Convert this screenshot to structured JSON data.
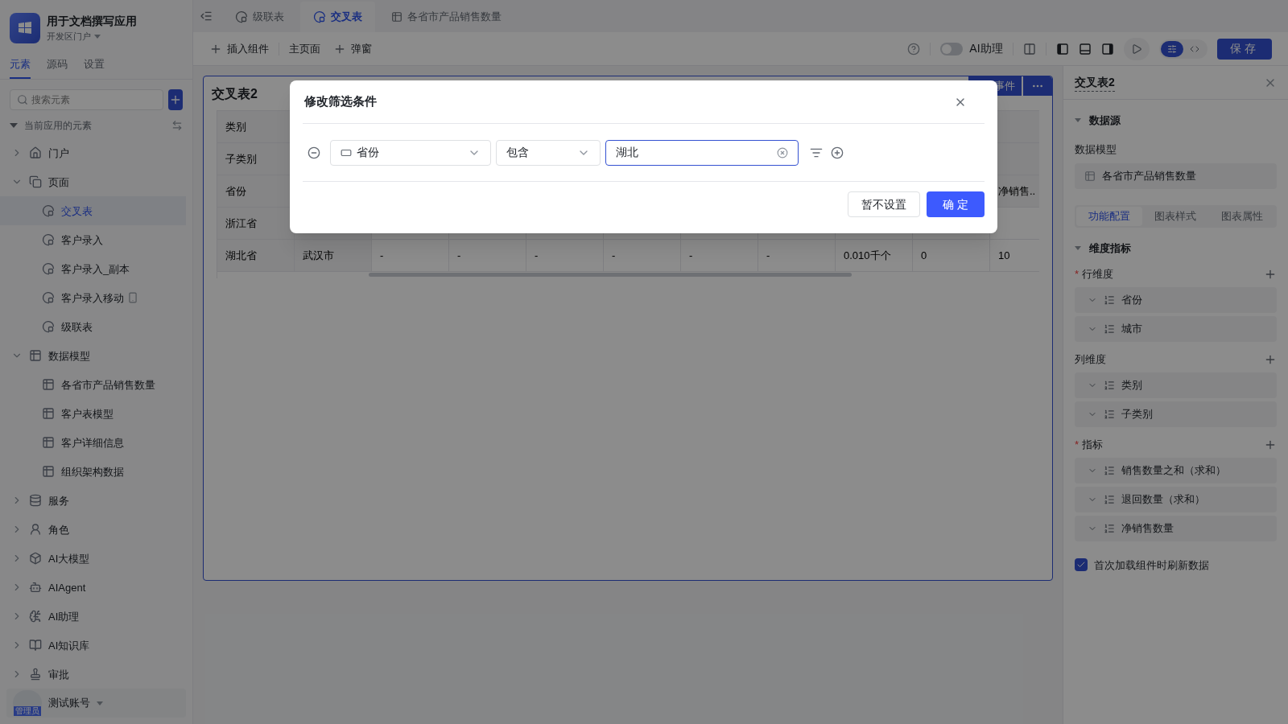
{
  "app": {
    "name": "用于文档撰写应用",
    "portal": "开发区门户"
  },
  "sidebar": {
    "tabs": [
      {
        "label": "元素",
        "selected": true
      },
      {
        "label": "源码",
        "selected": false
      },
      {
        "label": "设置",
        "selected": false
      }
    ],
    "search": {
      "placeholder": "搜索元素"
    },
    "tree": {
      "label": "当前应用的元素",
      "expanded": true,
      "children": [
        {
          "label": "门户",
          "kind": "portal",
          "expanded": false,
          "selected": false
        },
        {
          "label": "页面",
          "kind": "page",
          "expanded": true,
          "selected": false,
          "children": [
            {
              "label": "交叉表",
              "kind": "page-item",
              "selected": true
            },
            {
              "label": "客户录入",
              "kind": "page-item",
              "selected": false
            },
            {
              "label": "客户录入_副本",
              "kind": "page-item",
              "selected": false
            },
            {
              "label": "客户录入移动",
              "kind": "page-item",
              "selected": false,
              "mobile": true
            },
            {
              "label": "级联表",
              "kind": "page-item",
              "selected": false
            }
          ]
        },
        {
          "label": "数据模型",
          "kind": "data-model",
          "expanded": true,
          "selected": false,
          "children": [
            {
              "label": "各省市产品销售数量",
              "kind": "table",
              "selected": false
            },
            {
              "label": "客户表模型",
              "kind": "table",
              "selected": false
            },
            {
              "label": "客户详细信息",
              "kind": "table",
              "selected": false
            },
            {
              "label": "组织架构数据",
              "kind": "table",
              "selected": false
            }
          ]
        },
        {
          "label": "服务",
          "kind": "service",
          "expanded": false,
          "selected": false
        },
        {
          "label": "角色",
          "kind": "role",
          "expanded": false,
          "selected": false
        },
        {
          "label": "AI大模型",
          "kind": "ai-model",
          "expanded": false,
          "selected": false
        },
        {
          "label": "AIAgent",
          "kind": "ai-agent",
          "expanded": false,
          "selected": false
        },
        {
          "label": "AI助理",
          "kind": "ai-assistant",
          "expanded": false,
          "selected": false
        },
        {
          "label": "AI知识库",
          "kind": "ai-knowledge",
          "expanded": false,
          "selected": false
        },
        {
          "label": "审批",
          "kind": "approval",
          "expanded": false,
          "selected": false
        }
      ]
    },
    "user": {
      "name": "测试账号",
      "role": "管理员"
    }
  },
  "page_tabs": [
    {
      "label": "级联表",
      "kind": "page",
      "selected": false
    },
    {
      "label": "交叉表",
      "kind": "page",
      "selected": true
    },
    {
      "label": "各省市产品销售数量",
      "kind": "table",
      "selected": false
    }
  ],
  "toolbar": {
    "insert": "插入组件",
    "home": "主页面",
    "popup": "弹窗",
    "assistant": {
      "label": "AI助理",
      "on": false
    },
    "modes": [
      {
        "kind": "settings",
        "selected": true
      },
      {
        "kind": "code",
        "selected": false
      }
    ],
    "save": "保存"
  },
  "card": {
    "title": "交叉表2",
    "event_button": "事件",
    "table": {
      "header_rows": [
        {
          "label": "类别"
        },
        {
          "label": "子类别"
        },
        {
          "label": "省份",
          "last": "净销售.."
        }
      ],
      "rows": [
        {
          "province": "浙江省"
        },
        {
          "province": "湖北省",
          "city": "武汉市",
          "values": [
            "-",
            "-",
            "-",
            "-",
            "-",
            "-",
            "0.010千个",
            "0",
            "10"
          ]
        }
      ]
    }
  },
  "dialog": {
    "title": "修改筛选条件",
    "field": "省份",
    "operator": "包含",
    "value": "湖北",
    "cancel": "暂不设置",
    "ok": "确 定"
  },
  "panel": {
    "title": "交叉表2",
    "datasource": {
      "heading": "数据源",
      "label": "数据模型",
      "model": "各省市产品销售数量"
    },
    "tabs": [
      {
        "label": "功能配置",
        "selected": true
      },
      {
        "label": "图表样式",
        "selected": false
      },
      {
        "label": "图表属性",
        "selected": false
      }
    ],
    "dims_heading": "维度指标",
    "groups": [
      {
        "label": "行维度",
        "required_mark": "*",
        "items": [
          "省份",
          "城市"
        ]
      },
      {
        "label": "列维度",
        "items": [
          "类别",
          "子类别"
        ]
      },
      {
        "label": "指标",
        "required_mark": "*",
        "items": [
          "销售数量之和（求和）",
          "退回数量（求和）",
          "净销售数量"
        ]
      }
    ],
    "refresh": {
      "label": "首次加载组件时刷新数据",
      "checked": true
    }
  }
}
